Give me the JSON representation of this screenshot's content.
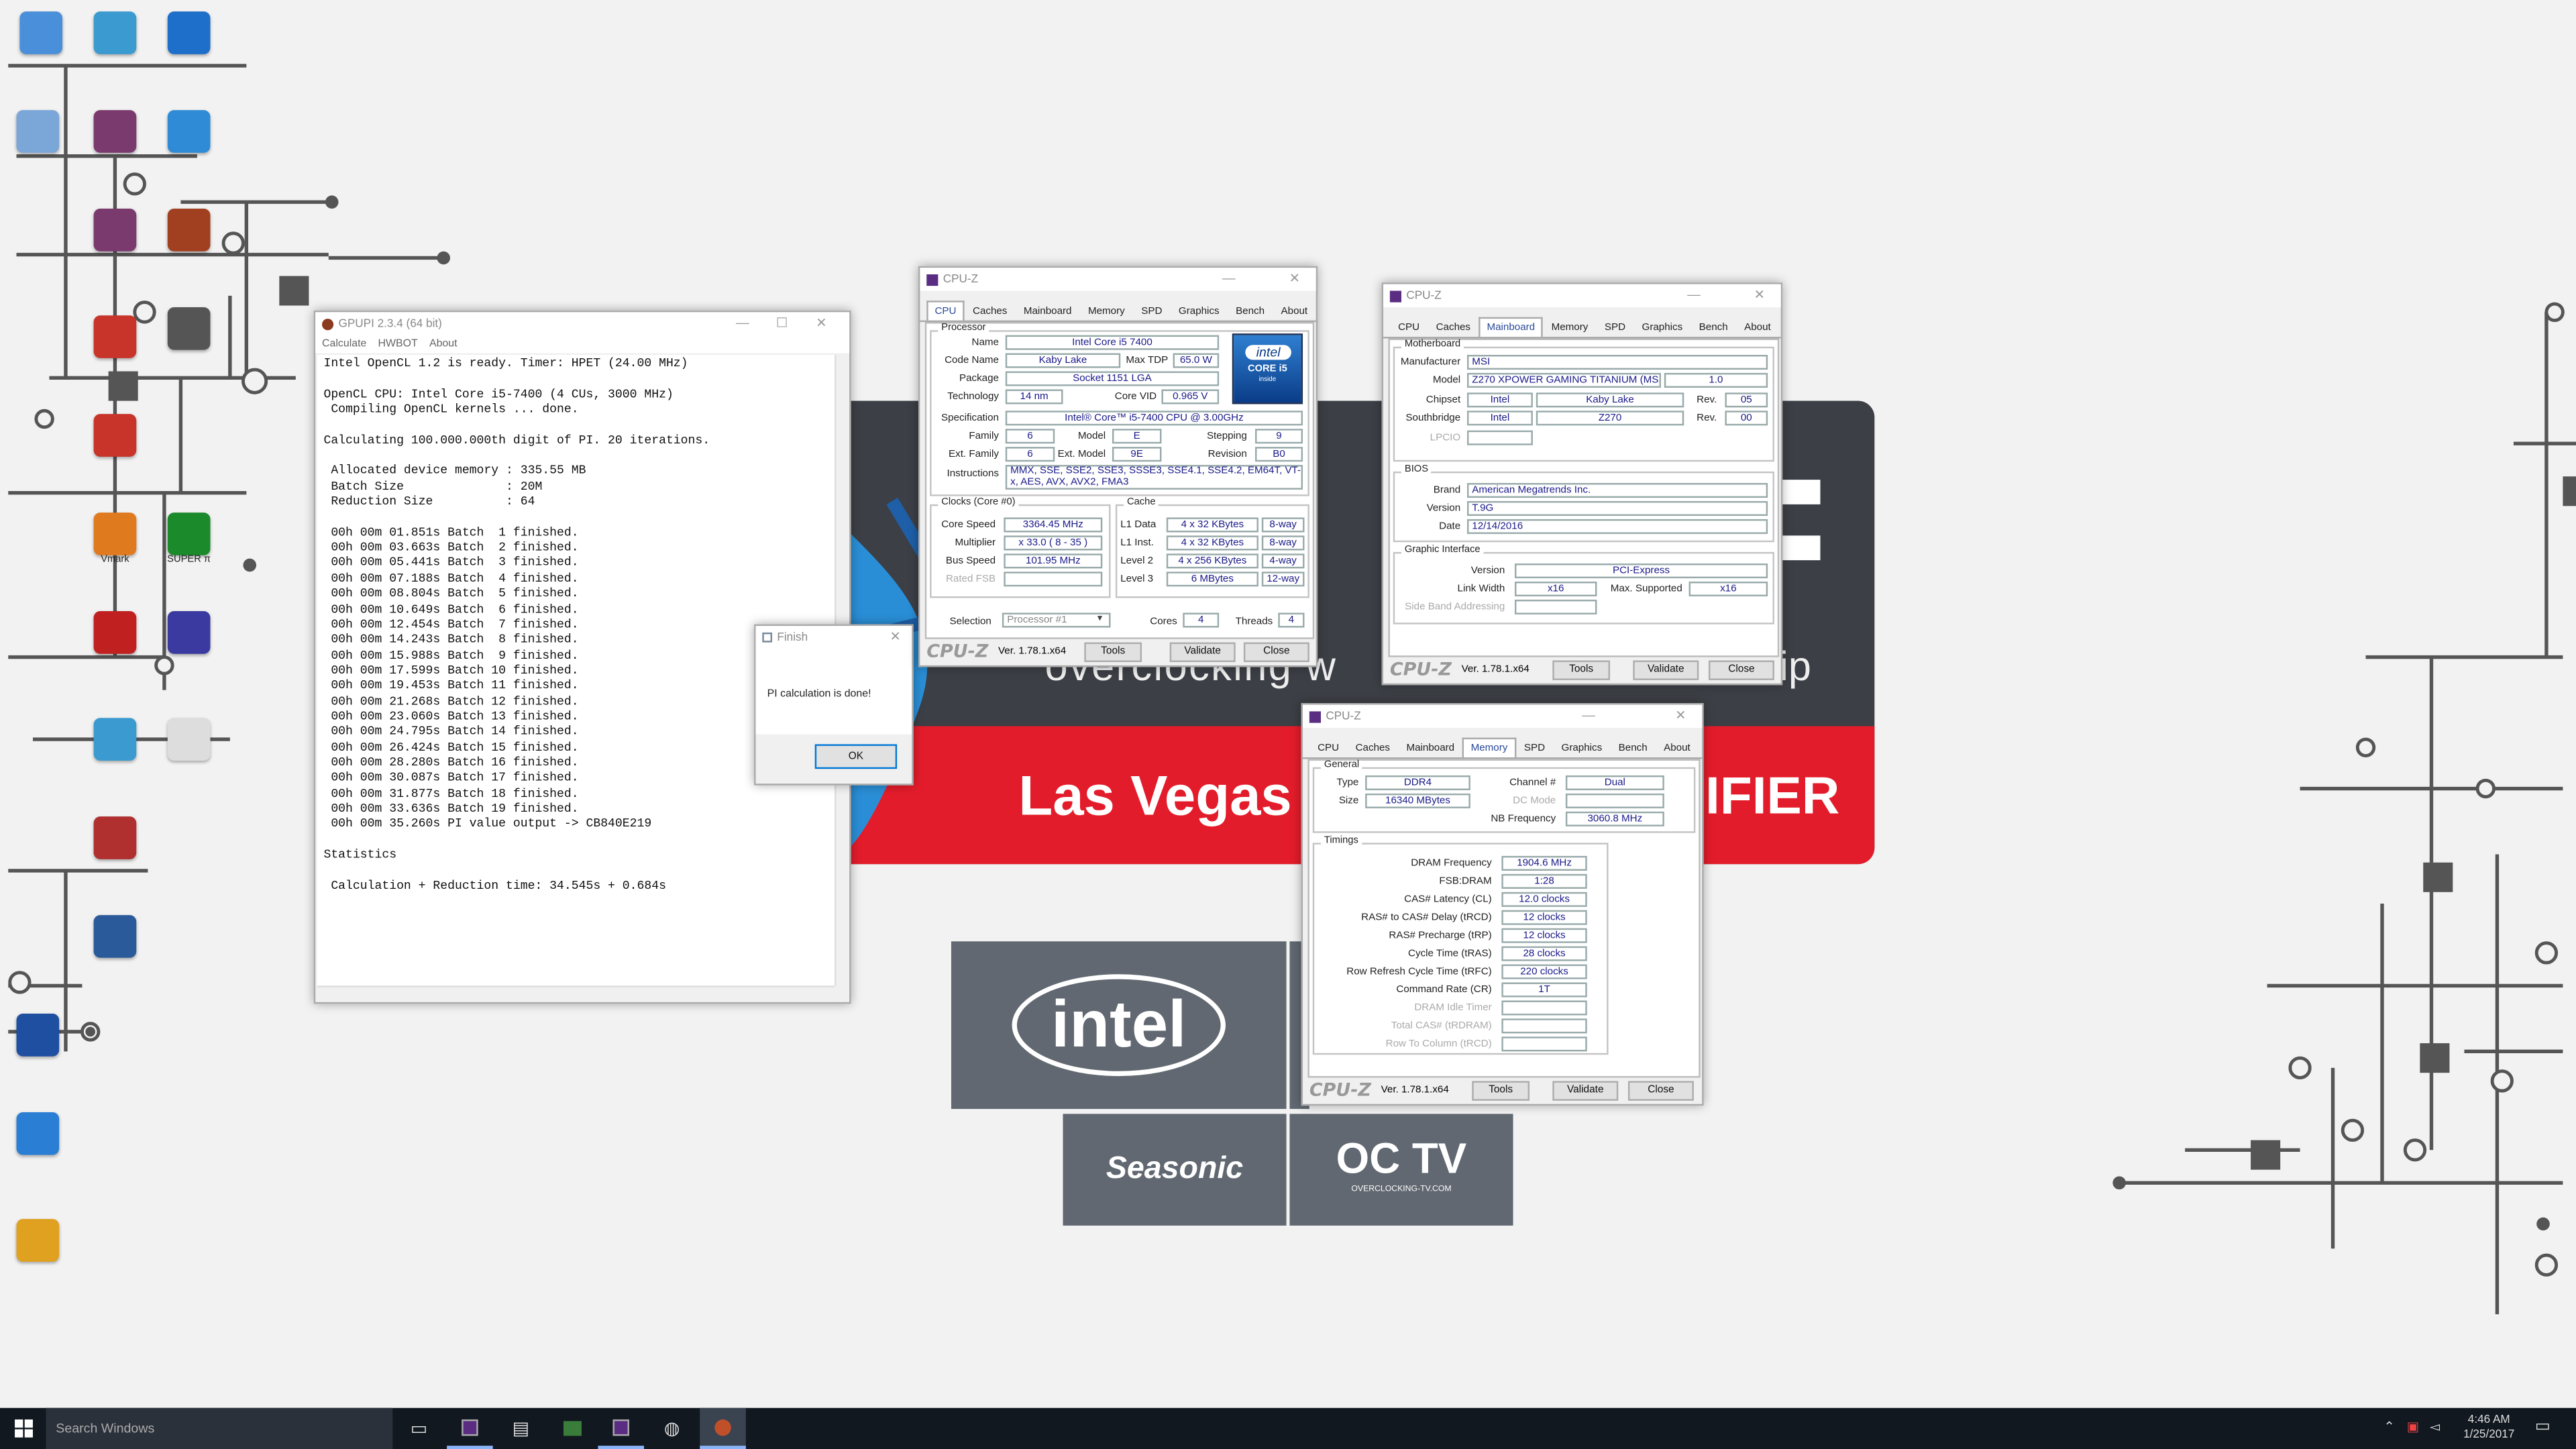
{
  "desktop": {
    "banner": {
      "tagline_left": "overclocking w",
      "tagline_right": "ip",
      "city": "Las Vegas",
      "red_suffix": "IFIER",
      "sponsors": [
        "intel",
        "Seasonic",
        "OC TV"
      ],
      "octv_caption": "OVERCLOCKING-TV.COM"
    },
    "icons": [
      {
        "name": "computer-icon",
        "label": ""
      },
      {
        "name": "control-panel-icon",
        "label": ""
      },
      {
        "name": "gpuz-icon",
        "label": ""
      },
      {
        "name": "recycle-bin-icon",
        "label": ""
      },
      {
        "name": "winrar-icon",
        "label": ""
      },
      {
        "name": "network-setup-icon",
        "label": ""
      },
      {
        "name": "winrar-icon-2",
        "label": ""
      },
      {
        "name": "aida-icon",
        "label": ""
      },
      {
        "name": "flower-app-icon",
        "label": ""
      },
      {
        "name": "cat-app-icon",
        "label": ""
      },
      {
        "name": "flower-app-icon-2",
        "label": ""
      },
      {
        "name": "vmark-icon",
        "label": "Vmark"
      },
      {
        "name": "superpi-icon",
        "label": "SUPER π"
      },
      {
        "name": "thaiphoon-icon",
        "label": ""
      },
      {
        "name": "memtest-icon",
        "label": ""
      },
      {
        "name": "shortcut-icon",
        "label": ""
      },
      {
        "name": "document-icon",
        "label": ""
      },
      {
        "name": "msi-icon",
        "label": ""
      },
      {
        "name": "cinebench-icon",
        "label": ""
      },
      {
        "name": "globe-icon",
        "label": ""
      },
      {
        "name": "window-icon",
        "label": ""
      },
      {
        "name": "installer-icon",
        "label": ""
      }
    ]
  },
  "gpupi": {
    "title": "GPUPI 2.3.4 (64 bit)",
    "menu": [
      "Calculate",
      "HWBOT",
      "About"
    ],
    "console_lines": [
      "Intel OpenCL 1.2 is ready. Timer: HPET (24.00 MHz)",
      "",
      "OpenCL CPU: Intel Core i5-7400 (4 CUs, 3000 MHz)",
      " Compiling OpenCL kernels ... done.",
      "",
      "Calculating 100.000.000th digit of PI. 20 iterations.",
      "",
      " Allocated device memory : 335.55 MB",
      " Batch Size              : 20M",
      " Reduction Size          : 64",
      "",
      " 00h 00m 01.851s Batch  1 finished.",
      " 00h 00m 03.663s Batch  2 finished.",
      " 00h 00m 05.441s Batch  3 finished.",
      " 00h 00m 07.188s Batch  4 finished.",
      " 00h 00m 08.804s Batch  5 finished.",
      " 00h 00m 10.649s Batch  6 finished.",
      " 00h 00m 12.454s Batch  7 finished.",
      " 00h 00m 14.243s Batch  8 finished.",
      " 00h 00m 15.988s Batch  9 finished.",
      " 00h 00m 17.599s Batch 10 finished.",
      " 00h 00m 19.453s Batch 11 finished.",
      " 00h 00m 21.268s Batch 12 finished.",
      " 00h 00m 23.060s Batch 13 finished.",
      " 00h 00m 24.795s Batch 14 finished.",
      " 00h 00m 26.424s Batch 15 finished.",
      " 00h 00m 28.280s Batch 16 finished.",
      " 00h 00m 30.087s Batch 17 finished.",
      " 00h 00m 31.877s Batch 18 finished.",
      " 00h 00m 33.636s Batch 19 finished.",
      " 00h 00m 35.260s PI value output -> CB840E219",
      "",
      "Statistics",
      "",
      " Calculation + Reduction time: 34.545s + 0.684s"
    ]
  },
  "finish_dialog": {
    "title": "Finish",
    "message": "PI calculation is done!",
    "ok_label": "OK"
  },
  "cpuz_tabs": [
    "CPU",
    "Caches",
    "Mainboard",
    "Memory",
    "SPD",
    "Graphics",
    "Bench",
    "About"
  ],
  "cpuz_common": {
    "title": "CPU-Z",
    "logo": "CPU-Z",
    "version": "Ver. 1.78.1.x64",
    "tools": "Tools",
    "validate": "Validate",
    "close": "Close"
  },
  "cpuz_cpu": {
    "active_tab": "CPU",
    "processor_group": "Processor",
    "name_label": "Name",
    "name": "Intel Core i5 7400",
    "codename_label": "Code Name",
    "codename": "Kaby Lake",
    "maxtdp_label": "Max TDP",
    "maxtdp": "65.0 W",
    "package_label": "Package",
    "package": "Socket 1151 LGA",
    "technology_label": "Technology",
    "technology": "14 nm",
    "corevid_label": "Core VID",
    "corevid": "0.965 V",
    "spec_label": "Specification",
    "spec": "Intel® Core™ i5-7400 CPU @ 3.00GHz",
    "family_label": "Family",
    "family": "6",
    "model_label": "Model",
    "model": "E",
    "stepping_label": "Stepping",
    "stepping": "9",
    "extfamily_label": "Ext. Family",
    "extfamily": "6",
    "extmodel_label": "Ext. Model",
    "extmodel": "9E",
    "revision_label": "Revision",
    "revision": "B0",
    "instructions_label": "Instructions",
    "instructions": "MMX, SSE, SSE2, SSE3, SSSE3, SSE4.1, SSE4.2, EM64T, VT-x, AES, AVX, AVX2, FMA3",
    "badge_brand": "intel",
    "badge_line": "CORE i5",
    "badge_sub": "inside",
    "clocks_group": "Clocks (Core #0)",
    "corespeed_label": "Core Speed",
    "corespeed": "3364.45 MHz",
    "multiplier_label": "Multiplier",
    "multiplier": "x 33.0 ( 8 - 35 )",
    "busspeed_label": "Bus Speed",
    "busspeed": "101.95 MHz",
    "ratedfsb_label": "Rated FSB",
    "ratedfsb": "",
    "cache_group": "Cache",
    "l1d_label": "L1 Data",
    "l1d": "4 x 32 KBytes",
    "l1d_way": "8-way",
    "l1i_label": "L1 Inst.",
    "l1i": "4 x 32 KBytes",
    "l1i_way": "8-way",
    "l2_label": "Level 2",
    "l2": "4 x 256 KBytes",
    "l2_way": "4-way",
    "l3_label": "Level 3",
    "l3": "6 MBytes",
    "l3_way": "12-way",
    "selection_label": "Selection",
    "selection": "Processor #1",
    "cores_label": "Cores",
    "cores": "4",
    "threads_label": "Threads",
    "threads": "4"
  },
  "cpuz_mb": {
    "active_tab": "Mainboard",
    "motherboard_group": "Motherboard",
    "manufacturer_label": "Manufacturer",
    "manufacturer": "MSI",
    "model_label": "Model",
    "model": "Z270 XPOWER GAMING TITANIUM (MS",
    "model_rev": "1.0",
    "chipset_label": "Chipset",
    "chipset_vendor": "Intel",
    "chipset": "Kaby Lake",
    "chipset_rev_label": "Rev.",
    "chipset_rev": "05",
    "southbridge_label": "Southbridge",
    "sb_vendor": "Intel",
    "sb": "Z270",
    "sb_rev_label": "Rev.",
    "sb_rev": "00",
    "lpcio_label": "LPCIO",
    "bios_group": "BIOS",
    "brand_label": "Brand",
    "brand": "American Megatrends Inc.",
    "version_label": "Version",
    "version": "T.9G",
    "date_label": "Date",
    "date": "12/14/2016",
    "gi_group": "Graphic Interface",
    "gi_version_label": "Version",
    "gi_version": "PCI-Express",
    "linkwidth_label": "Link Width",
    "linkwidth": "x16",
    "maxsup_label": "Max. Supported",
    "maxsup": "x16",
    "sideband_label": "Side Band Addressing"
  },
  "cpuz_mem": {
    "active_tab": "Memory",
    "general_group": "General",
    "type_label": "Type",
    "type": "DDR4",
    "channel_label": "Channel #",
    "channel": "Dual",
    "size_label": "Size",
    "size": "16340 MBytes",
    "dcmode_label": "DC Mode",
    "nbfreq_label": "NB Frequency",
    "nbfreq": "3060.8 MHz",
    "timings_group": "Timings",
    "rows": [
      {
        "label": "DRAM Frequency",
        "value": "1904.6 MHz",
        "dim": false
      },
      {
        "label": "FSB:DRAM",
        "value": "1:28",
        "dim": false
      },
      {
        "label": "CAS# Latency (CL)",
        "value": "12.0 clocks",
        "dim": false
      },
      {
        "label": "RAS# to CAS# Delay (tRCD)",
        "value": "12 clocks",
        "dim": false
      },
      {
        "label": "RAS# Precharge (tRP)",
        "value": "12 clocks",
        "dim": false
      },
      {
        "label": "Cycle Time (tRAS)",
        "value": "28 clocks",
        "dim": false
      },
      {
        "label": "Row Refresh Cycle Time (tRFC)",
        "value": "220 clocks",
        "dim": false
      },
      {
        "label": "Command Rate (CR)",
        "value": "1T",
        "dim": false
      },
      {
        "label": "DRAM Idle Timer",
        "value": "",
        "dim": true
      },
      {
        "label": "Total CAS# (tRDRAM)",
        "value": "",
        "dim": true
      },
      {
        "label": "Row To Column (tRCD)",
        "value": "",
        "dim": true
      }
    ]
  },
  "taskbar": {
    "search_placeholder": "Search Windows",
    "time": "4:46 AM",
    "date": "1/25/2017"
  }
}
